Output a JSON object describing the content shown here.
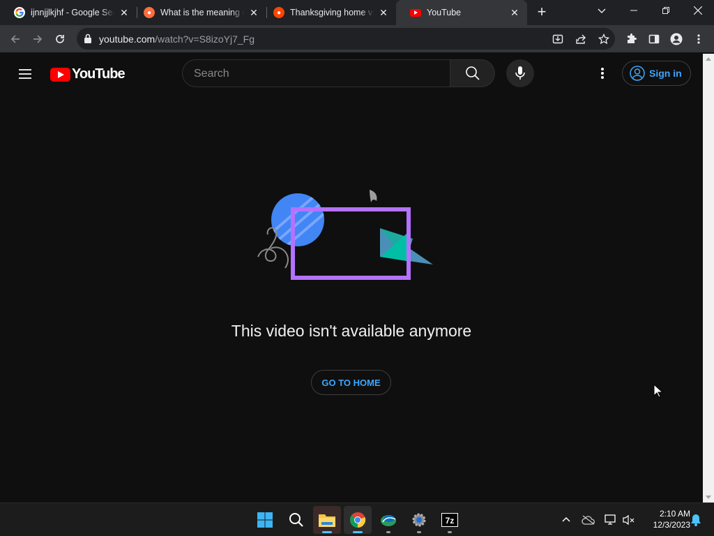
{
  "browser": {
    "tabs": [
      {
        "title": "ijnnjjlkjhf - Google Search",
        "favicon": "google-icon",
        "active": false
      },
      {
        "title": "What is the meaning of",
        "favicon": "reddit-icon",
        "active": false
      },
      {
        "title": "Thanksgiving home videos",
        "favicon": "reddit-icon",
        "active": false
      },
      {
        "title": "YouTube",
        "favicon": "youtube-icon",
        "active": true
      }
    ],
    "url_host": "youtube.com",
    "url_path": "/watch?v=S8izoYj7_Fg"
  },
  "youtube": {
    "search_placeholder": "Search",
    "sign_in_label": "Sign in",
    "logo_text": "YouTube",
    "message": "This video isn't available anymore",
    "go_home_label": "GO TO HOME",
    "accent": "#3ea6ff"
  },
  "taskbar": {
    "apps": [
      "start-icon",
      "search-icon",
      "file-explorer-icon",
      "chrome-icon",
      "edge-dev-icon",
      "settings-icon",
      "7zip-icon"
    ],
    "time": "2:10 AM",
    "date": "12/3/2023"
  }
}
